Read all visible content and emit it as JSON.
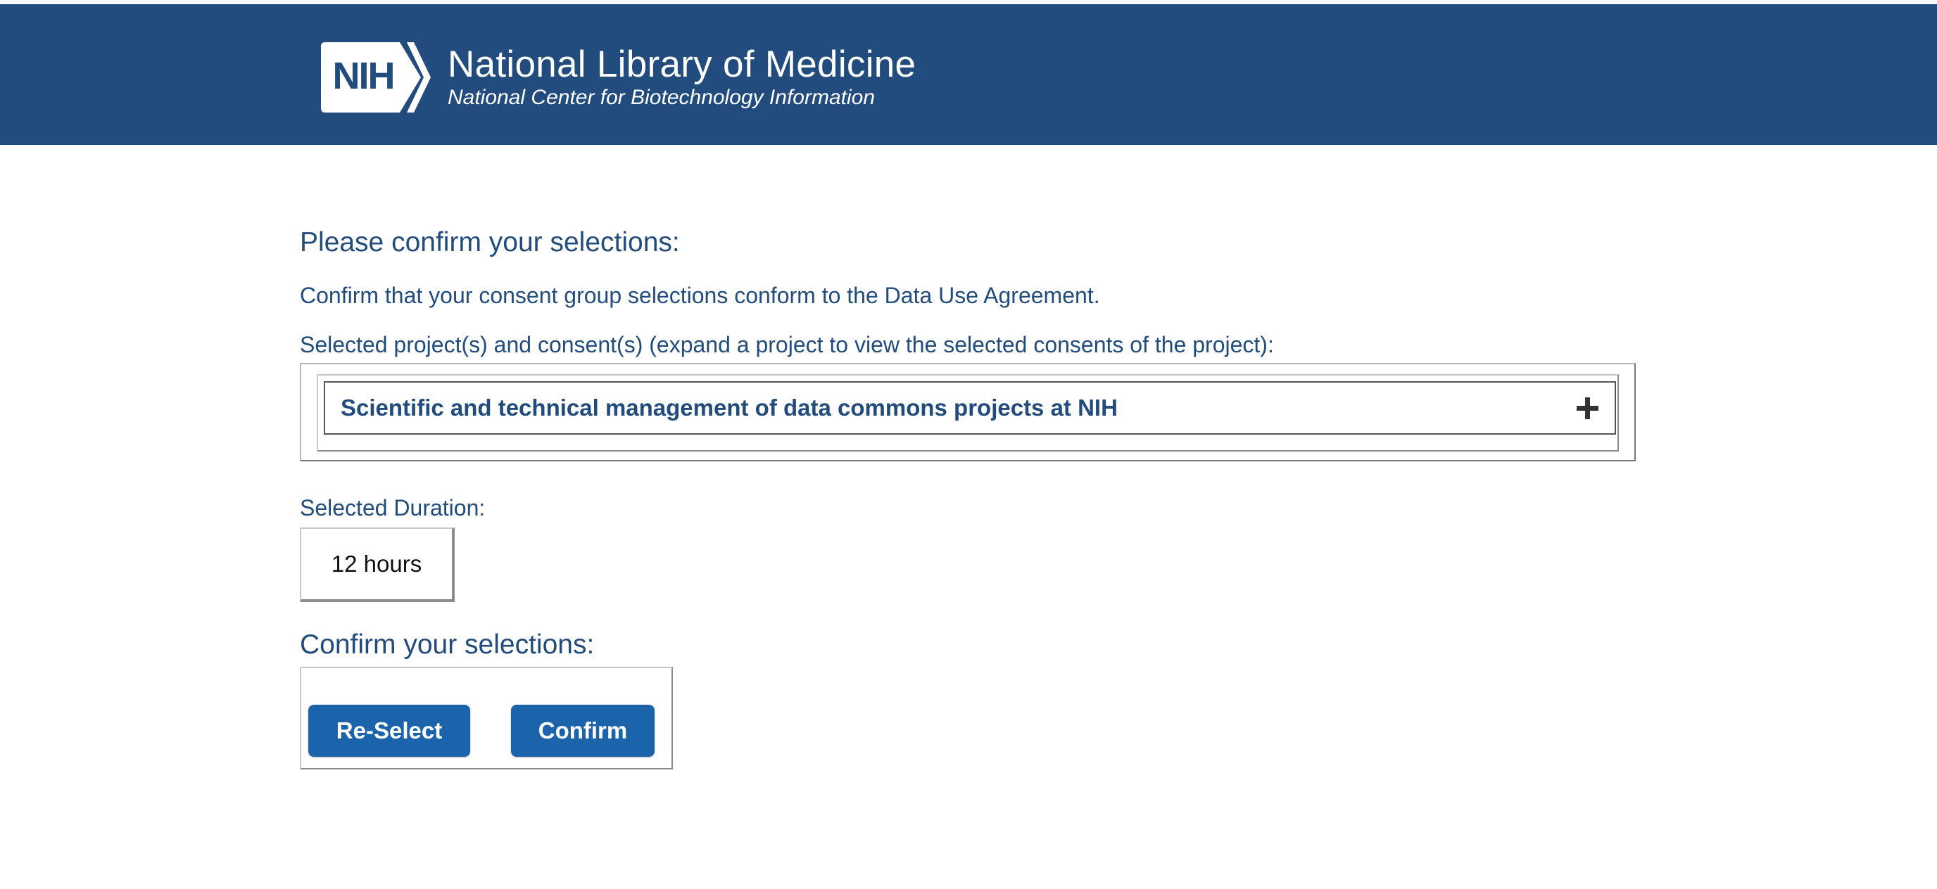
{
  "header": {
    "logo_badge_text": "NIH",
    "title": "National Library of Medicine",
    "subtitle": "National Center for Biotechnology Information",
    "background_color": "#224c7d"
  },
  "main": {
    "heading": "Please confirm your selections:",
    "instruction": "Confirm that your consent group selections conform to the Data Use Agreement.",
    "projects_label": "Selected project(s) and consent(s) (expand a project to view the selected consents of the project):",
    "projects": [
      {
        "title": "Scientific and technical management of data commons projects at NIH",
        "expand_icon": "plus-icon"
      }
    ],
    "duration_label": "Selected Duration:",
    "duration_value": "12 hours",
    "confirm_heading": "Confirm your selections:",
    "buttons": {
      "reselect": "Re-Select",
      "confirm": "Confirm"
    },
    "accent_color": "#1b63ab",
    "text_color": "#224c7d"
  }
}
